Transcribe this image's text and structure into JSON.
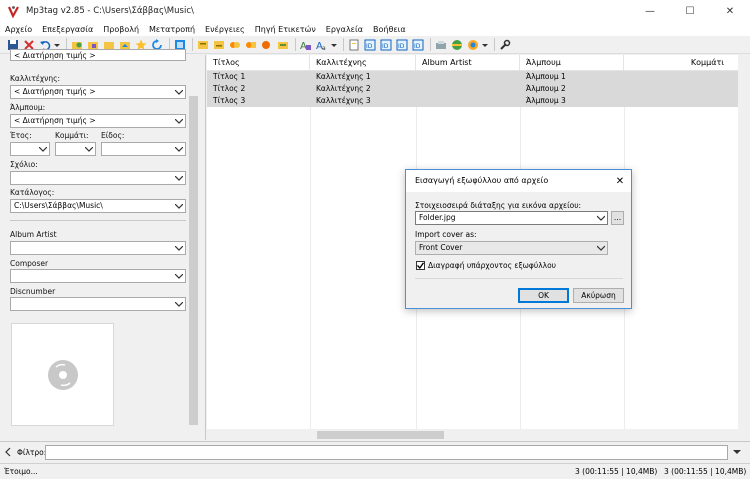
{
  "window": {
    "title": "Mp3tag v2.85  -  C:\\Users\\Σάββας\\Music\\",
    "minimize": "—",
    "maximize": "☐",
    "close": "✕"
  },
  "menu": [
    "Αρχείο",
    "Επεξεργασία",
    "Προβολή",
    "Μετατροπή",
    "Ενέργειες",
    "Πηγή Ετικετών",
    "Εργαλεία",
    "Βοήθεια"
  ],
  "left_panel": {
    "top_combo": "< Διατήρηση τιμής >",
    "artist_label": "Καλλιτέχνης:",
    "artist_value": "< Διατήρηση τιμής >",
    "album_label": "Άλμπουμ:",
    "album_value": "< Διατήρηση τιμής >",
    "year_label": "Έτος:",
    "track_label": "Κομμάτι:",
    "genre_label": "Είδος:",
    "comment_label": "Σχόλιο:",
    "directory_label": "Κατάλογος:",
    "directory_value": "C:\\Users\\Σάββας\\Music\\",
    "album_artist_label": "Album Artist",
    "composer_label": "Composer",
    "discnumber_label": "Discnumber"
  },
  "file_list": {
    "columns": [
      "Τίτλος",
      "Καλλιτέχνης",
      "Album Artist",
      "Άλμπουμ",
      "Κομμάτι"
    ],
    "rows": [
      {
        "title": "Τίτλος 1",
        "artist": "Καλλιτέχνης 1",
        "album_artist": "",
        "album": "Άλμπουμ 1",
        "track": ""
      },
      {
        "title": "Τίτλος 2",
        "artist": "Καλλιτέχνης 2",
        "album_artist": "",
        "album": "Άλμπουμ 2",
        "track": ""
      },
      {
        "title": "Τίτλος 3",
        "artist": "Καλλιτέχνης 3",
        "album_artist": "",
        "album": "Άλμπουμ 3",
        "track": ""
      }
    ]
  },
  "filter": {
    "label": "Φίλτρο:",
    "value": ""
  },
  "status": {
    "left": "Έτοιμο...",
    "mid": "3 (00:11:55 | 10,4MB)",
    "right": "3 (00:11:55 | 10,4MB)"
  },
  "dialog": {
    "title": "Εισαγωγή εξωφύλλου από αρχείο",
    "close": "✕",
    "filename_label": "Στοιχειοσειρά διάταξης για εικόνα αρχείου:",
    "filename_value": "Folder.jpg",
    "browse": "...",
    "import_label": "Import cover as:",
    "import_value": "Front Cover",
    "delete_label": "Διαγραφή υπάρχοντος εξωφύλλου",
    "delete_checked": true,
    "ok": "OK",
    "cancel": "Ακύρωση"
  },
  "colors": {
    "selection": "#d9d9d9",
    "dialog_border": "#4a8fd8",
    "accent": "#0078d7"
  }
}
